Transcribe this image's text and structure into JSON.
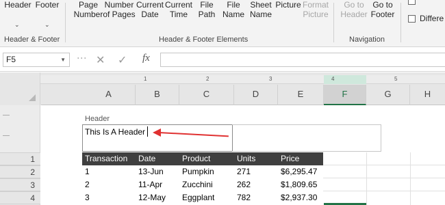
{
  "ribbon": {
    "groups": {
      "header_footer": {
        "label": "Header & Footer",
        "header_button": "Header",
        "footer_button": "Footer"
      },
      "elements": {
        "label": "Header & Footer Elements",
        "buttons": [
          {
            "label": "Page\nNumber"
          },
          {
            "label": "Number\nof Pages"
          },
          {
            "label": "Current\nDate"
          },
          {
            "label": "Current\nTime"
          },
          {
            "label": "File\nPath"
          },
          {
            "label": "File\nName"
          },
          {
            "label": "Sheet\nName"
          },
          {
            "label": "Picture"
          },
          {
            "label": "Format\nPicture"
          }
        ]
      },
      "navigation": {
        "label": "Navigation",
        "buttons": [
          {
            "label": "Go to\nHeader"
          },
          {
            "label": "Go to\nFooter"
          }
        ]
      },
      "options": {
        "different_label": "Differe"
      }
    }
  },
  "formula_bar": {
    "name_box": "F5",
    "cancel_icon": "✕",
    "enter_icon": "✓",
    "fx_label": "fx",
    "value": ""
  },
  "ruler": {
    "marks": [
      "1",
      "2",
      "3",
      "4",
      "5"
    ]
  },
  "columns": [
    "A",
    "B",
    "C",
    "D",
    "E",
    "F",
    "G",
    "H"
  ],
  "selected_column": "F",
  "rows": [
    "1",
    "2",
    "3",
    "4"
  ],
  "page_header": {
    "caption": "Header",
    "text": "This Is A Header"
  },
  "table": {
    "headers": [
      "Transaction",
      "Date",
      "Product",
      "Units",
      "Price"
    ],
    "rows": [
      [
        "1",
        "13-Jun",
        "Pumpkin",
        "271",
        "$6,295.47"
      ],
      [
        "2",
        "11-Apr",
        "Zucchini",
        "262",
        "$1,809.65"
      ],
      [
        "3",
        "12-May",
        "Eggplant",
        "782",
        "$2,937.30"
      ]
    ]
  },
  "colors": {
    "accent": "#217346",
    "annotation_arrow": "#e03131",
    "table_header_bg": "#3f3f3f"
  }
}
